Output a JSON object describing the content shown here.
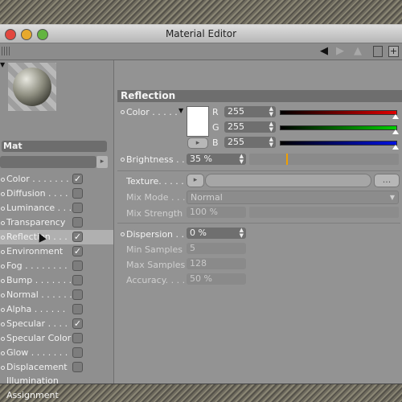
{
  "window": {
    "title": "Material Editor"
  },
  "toolbar": {
    "back_icon": "back-arrow-icon",
    "forward_icon": "forward-arrow-icon",
    "lock_icon": "lock-icon",
    "new_icon": "new-window-icon"
  },
  "material": {
    "name": "Mat"
  },
  "channels": [
    {
      "label": "Color . . . . . . . .",
      "checked": true
    },
    {
      "label": "Diffusion . . . .",
      "checked": false
    },
    {
      "label": "Luminance . . .",
      "checked": false
    },
    {
      "label": "Transparency",
      "checked": false
    },
    {
      "label": "Reflection . . .",
      "checked": true
    },
    {
      "label": "Environment",
      "checked": true
    },
    {
      "label": "Fog . . . . . . . .",
      "checked": false
    },
    {
      "label": "Bump . . . . . . .",
      "checked": false
    },
    {
      "label": "Normal . . . . . .",
      "checked": false
    },
    {
      "label": "Alpha . . . . . .",
      "checked": false
    },
    {
      "label": "Specular . . . .",
      "checked": true
    },
    {
      "label": "Specular Color",
      "checked": false
    },
    {
      "label": "Glow . . . . . . .",
      "checked": false
    },
    {
      "label": "Displacement",
      "checked": false
    }
  ],
  "extra_items": [
    "Illumination",
    "Assignment"
  ],
  "section": {
    "title": "Reflection"
  },
  "color": {
    "label": "Color . . . . .",
    "swatch": "#ffffff",
    "r_label": "R",
    "r_value": "255",
    "g_label": "G",
    "g_value": "255",
    "b_label": "B",
    "b_value": "255"
  },
  "brightness": {
    "label": "Brightness . . .",
    "value": "35 %",
    "level": 0.35
  },
  "texture": {
    "label": "Texture. . . . . .",
    "browse_label": "..."
  },
  "mix_mode": {
    "label": "Mix Mode . . .",
    "value": "Normal"
  },
  "mix_strength": {
    "label": "Mix Strength",
    "value": "100 %"
  },
  "dispersion": {
    "label": "Dispersion . . .",
    "value": "0 %"
  },
  "min_samples": {
    "label": "Min Samples",
    "value": "5"
  },
  "max_samples": {
    "label": "Max Samples",
    "value": "128"
  },
  "accuracy": {
    "label": "Accuracy. . . .",
    "value": "50 %"
  }
}
